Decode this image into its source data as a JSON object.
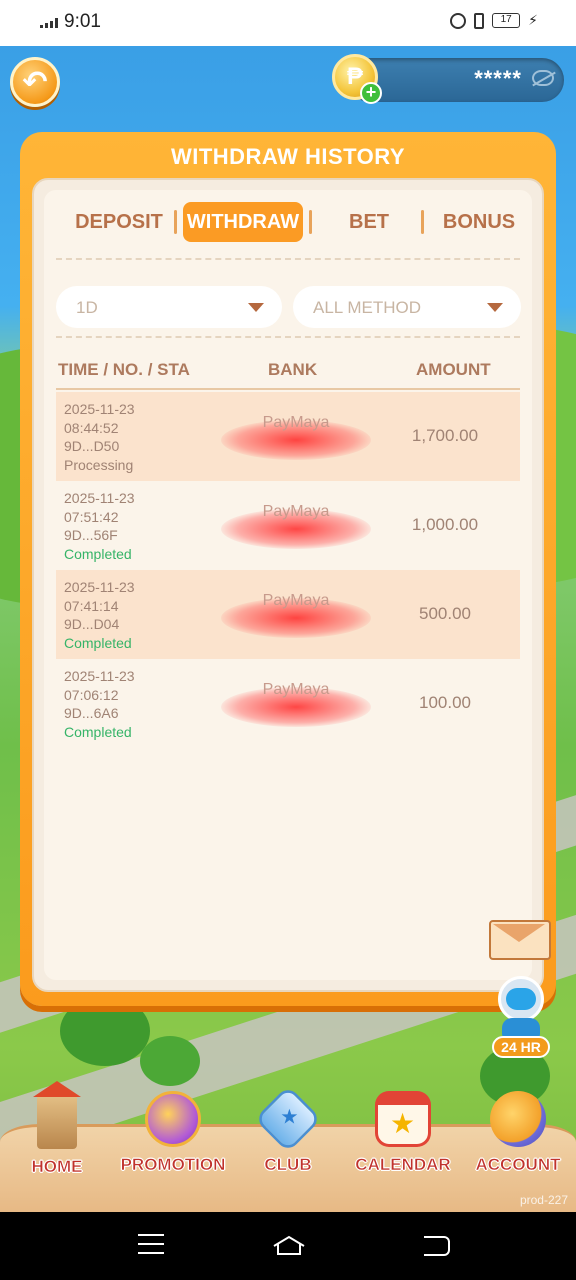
{
  "status_bar": {
    "time": "9:01",
    "battery": "17"
  },
  "header": {
    "balance_masked": "*****",
    "currency_symbol": "₱",
    "plus": "+"
  },
  "panel": {
    "title": "WITHDRAW HISTORY",
    "tabs": [
      {
        "label": "DEPOSIT",
        "active": false
      },
      {
        "label": "WITHDRAW",
        "active": true
      },
      {
        "label": "BET",
        "active": false
      },
      {
        "label": "BONUS",
        "active": false
      }
    ],
    "filters": {
      "period": "1D",
      "method": "ALL METHOD"
    },
    "columns": {
      "time": "TIME / NO. / STA",
      "bank": "BANK",
      "amount": "AMOUNT"
    },
    "rows": [
      {
        "date": "2025-11-23",
        "time": "08:44:52",
        "no": "9D...D50",
        "status": "Processing",
        "bank": "PayMaya",
        "amount": "1,700.00"
      },
      {
        "date": "2025-11-23",
        "time": "07:51:42",
        "no": "9D...56F",
        "status": "Completed",
        "bank": "PayMaya",
        "amount": "1,000.00"
      },
      {
        "date": "2025-11-23",
        "time": "07:41:14",
        "no": "9D...D04",
        "status": "Completed",
        "bank": "PayMaya",
        "amount": "500.00"
      },
      {
        "date": "2025-11-23",
        "time": "07:06:12",
        "no": "9D...6A6",
        "status": "Completed",
        "bank": "PayMaya",
        "amount": "100.00"
      }
    ]
  },
  "support": {
    "badge": "24 HR"
  },
  "bottom_nav": [
    {
      "label": "HOME",
      "icon": "tower-icon"
    },
    {
      "label": "PROMOTION",
      "icon": "gift-wheel-icon"
    },
    {
      "label": "CLUB",
      "icon": "star-badge-icon"
    },
    {
      "label": "CALENDAR",
      "icon": "calendar-icon"
    },
    {
      "label": "ACCOUNT",
      "icon": "avatar-icon"
    }
  ],
  "build_label": "prod-227",
  "colors": {
    "accent": "#fb9b24",
    "completed": "#36b468",
    "nav_label": "#c0322c"
  }
}
